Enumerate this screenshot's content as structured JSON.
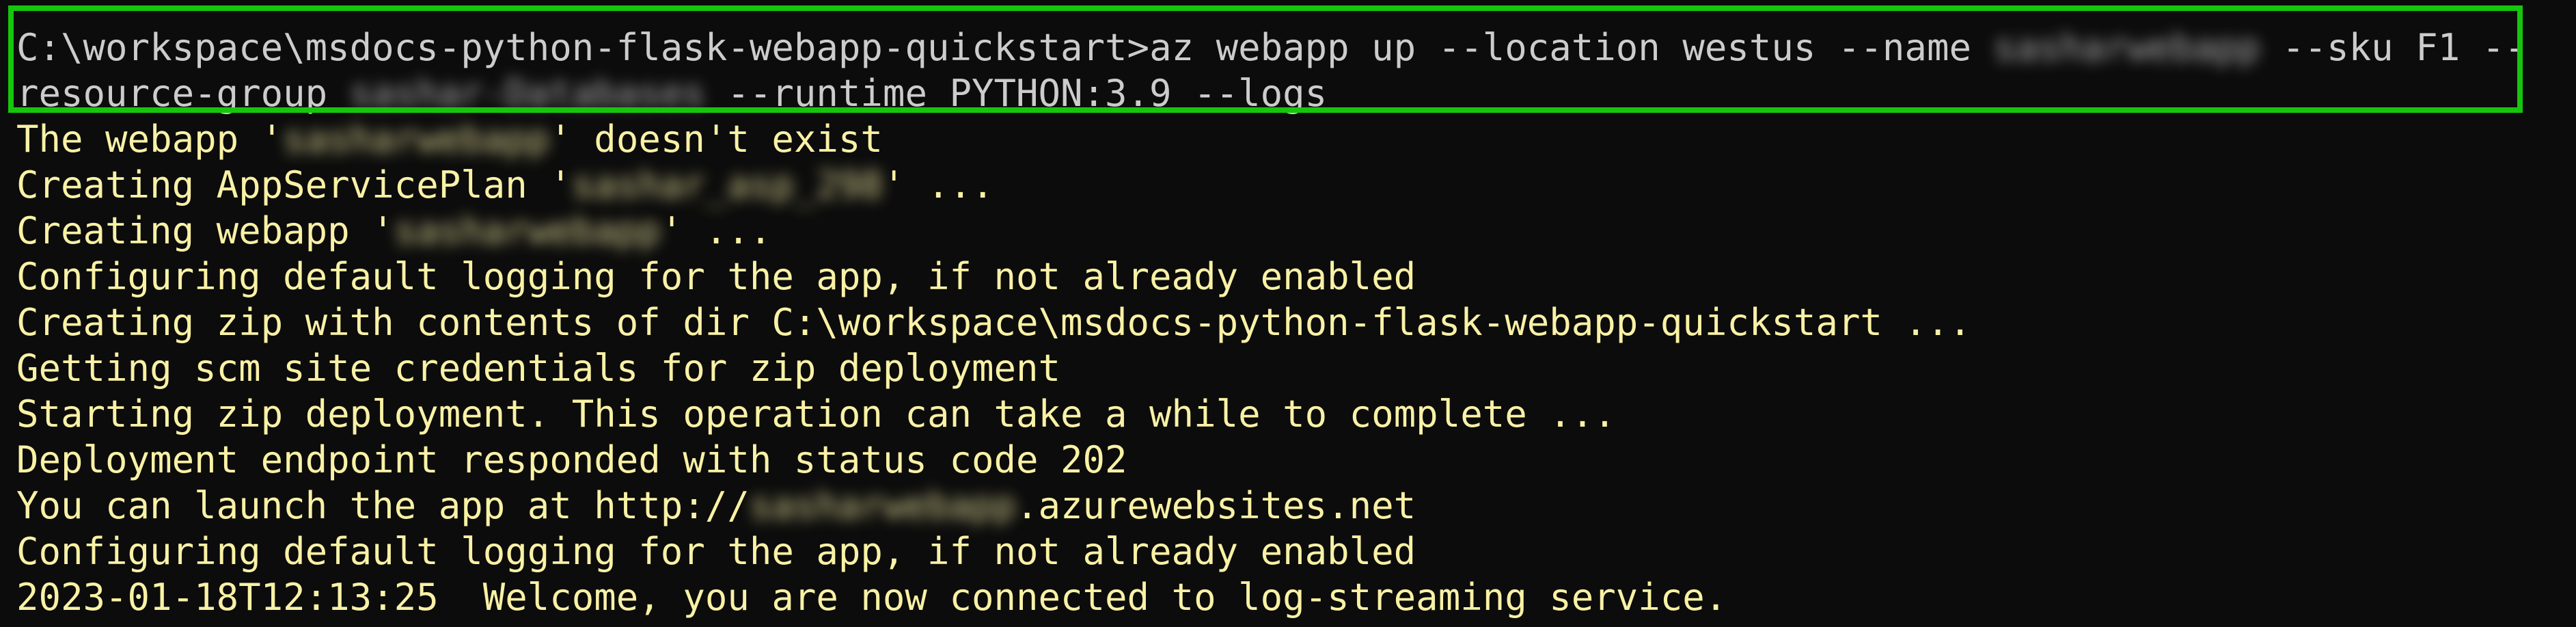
{
  "command": {
    "prompt": "C:\\workspace\\msdocs-python-flask-webapp-quickstart>",
    "text_1": "az webapp up --location westus --name ",
    "redacted_name": "sasharwebapp",
    "text_2": " --sku F1 --",
    "line2_text_1": "resource-group ",
    "redacted_group": "sashar-Databases",
    "line2_text_2": " --runtime PYTHON:3.9 --logs"
  },
  "output": {
    "line_1": {
      "pre": "The webapp '",
      "redacted": "sasharwebapp",
      "post": "' doesn't exist"
    },
    "line_2": {
      "pre": "Creating AppServicePlan '",
      "redacted": "sashar_asp_298",
      "post": "' ..."
    },
    "line_3": {
      "pre": "Creating webapp '",
      "redacted": "sasharwebapp",
      "post": "' ..."
    },
    "line_4": "Configuring default logging for the app, if not already enabled",
    "line_5": "Creating zip with contents of dir C:\\workspace\\msdocs-python-flask-webapp-quickstart ...",
    "line_6": "Getting scm site credentials for zip deployment",
    "line_7": "Starting zip deployment. This operation can take a while to complete ...",
    "line_8": "Deployment endpoint responded with status code 202",
    "line_9": {
      "pre": "You can launch the app at http://",
      "redacted": "sasharwebapp",
      "post": ".azurewebsites.net"
    },
    "line_10": "Configuring default logging for the app, if not already enabled",
    "line_11": "2023-01-18T12:13:25  Welcome, you are now connected to log-streaming service."
  },
  "colors": {
    "background": "#0c0c0c",
    "command_text": "#cccccc",
    "output_text": "#f9f1a5",
    "highlight_border": "#16c60c"
  }
}
